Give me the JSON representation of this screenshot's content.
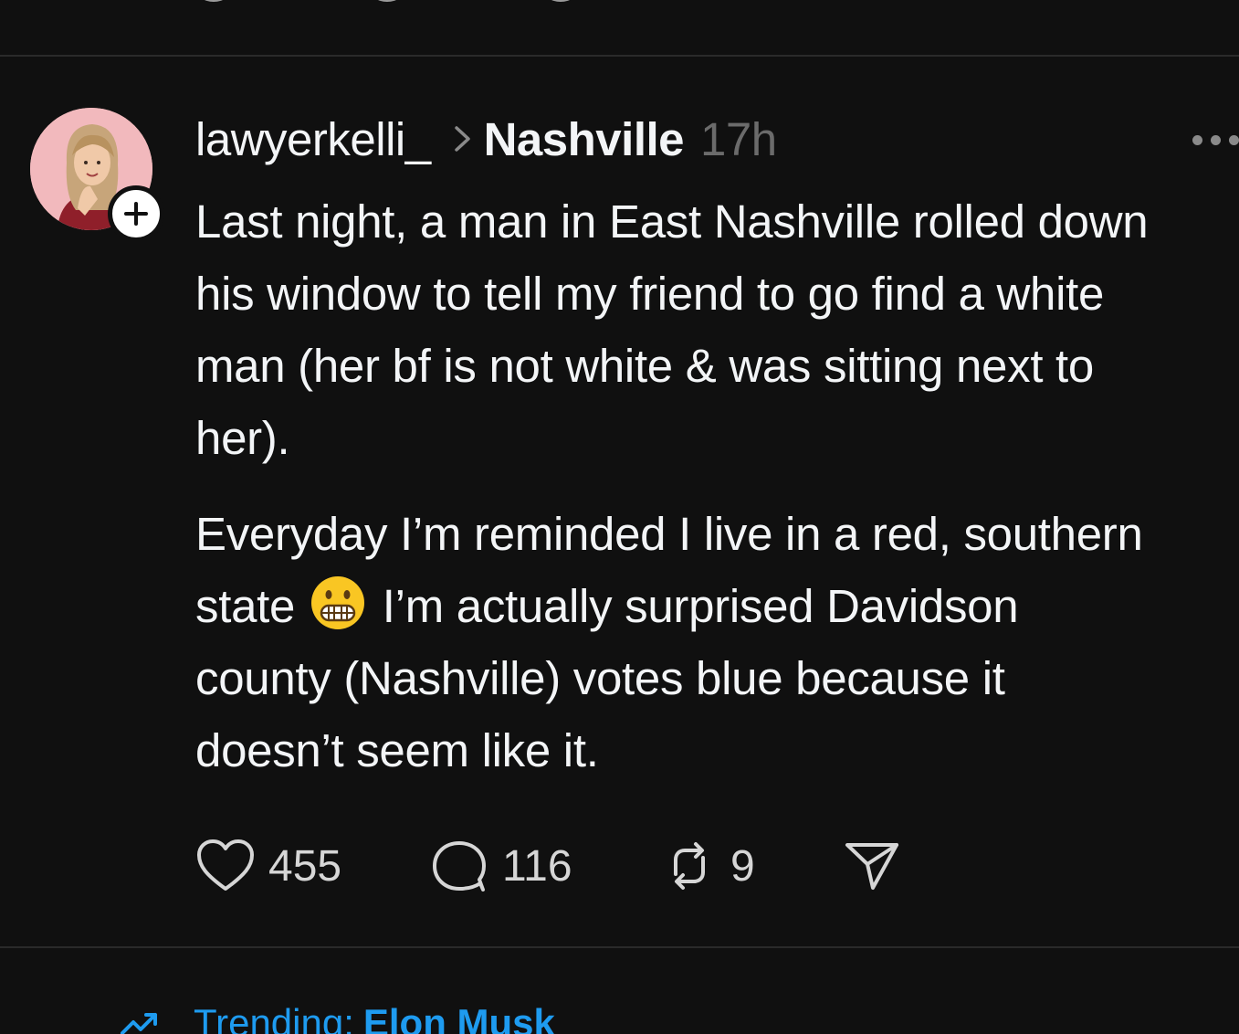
{
  "post": {
    "username": "lawyerkelli_",
    "topic": "Nashville",
    "timestamp": "17h",
    "body_paragraph_1": [
      "Last night, a man in East Nashville rolled down",
      "his window to tell my friend to go find a white",
      "man (her bf is not white & was sitting next to",
      "her)."
    ],
    "body_paragraph_2": {
      "line1": "Everyday I’m reminded I live in a red, southern",
      "line2_before_emoji": "state ",
      "emoji": "grimacing-face",
      "line2_after_emoji": " I’m actually surprised Davidson",
      "line3": "county (Nashville) votes blue because it",
      "line4": "doesn’t seem like it."
    },
    "likes": "455",
    "replies": "116",
    "reposts": "9"
  },
  "trending": {
    "label": "Trending:",
    "topic": "Elon Musk"
  },
  "colors": {
    "background": "#101010",
    "text": "#f3f5f7",
    "muted": "#6b6b6b",
    "link": "#1e9bf0",
    "avatar_bg": "#f2b9bd"
  },
  "icons": [
    "follow-plus-icon",
    "chevron-right-icon",
    "more-icon",
    "heart-icon",
    "comment-icon",
    "repost-icon",
    "share-icon",
    "trending-icon"
  ]
}
